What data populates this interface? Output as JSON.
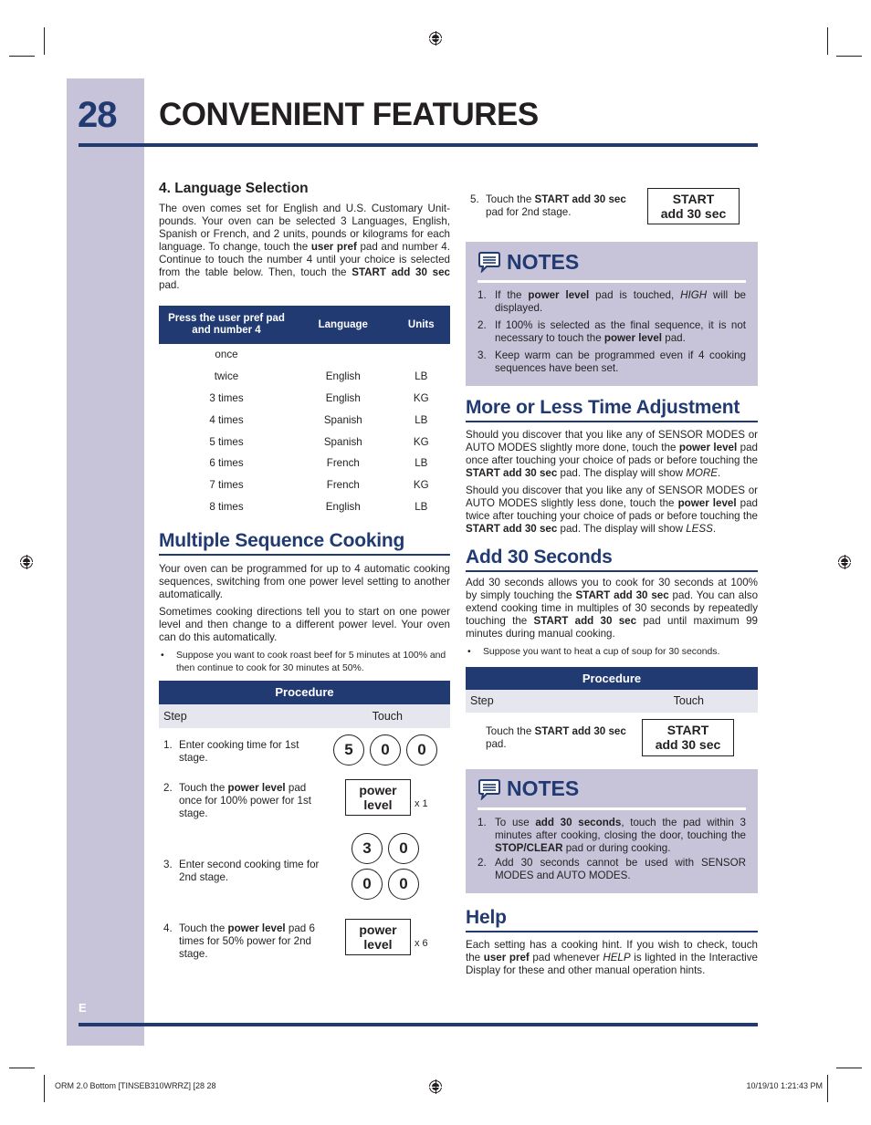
{
  "page": {
    "number": "28",
    "title": "CONVENIENT FEATURES",
    "language_tab": "E",
    "colors": {
      "accent": "#213a72",
      "sidebar": "#c7c4da",
      "notes_bg": "#c7c4da",
      "table_subheader": "#e6e6ee"
    }
  },
  "language_selection": {
    "heading": "4. Language Selection",
    "body_1": "The oven comes set for English and U.S. Customary Unit-pounds. Your oven can be selected 3 Languages, English, Spanish or French, and 2 units, pounds or kilograms for each language. To change, touch the ",
    "body_bold_1": "user pref",
    "body_2": " pad and number 4. Continue to touch the number 4 until your choice is selected from the table below. Then, touch the ",
    "body_bold_2": "START add 30 sec",
    "body_3": " pad.",
    "table": {
      "headers": [
        "Press the user pref pad and number 4",
        "Language",
        "Units"
      ],
      "rows": [
        [
          "once",
          "",
          ""
        ],
        [
          "twice",
          "English",
          "LB"
        ],
        [
          "3 times",
          "English",
          "KG"
        ],
        [
          "4 times",
          "Spanish",
          "LB"
        ],
        [
          "5 times",
          "Spanish",
          "KG"
        ],
        [
          "6 times",
          "French",
          "LB"
        ],
        [
          "7 times",
          "French",
          "KG"
        ],
        [
          "8 times",
          "English",
          "LB"
        ]
      ]
    }
  },
  "multiple_sequence": {
    "heading": "Multiple Sequence Cooking",
    "para_1": "Your oven can be programmed for up to 4 automatic cooking sequences, switching from one power level setting to another automatically.",
    "para_2": "Sometimes cooking directions tell you to start on one power level and then change to a different power level. Your oven can do this automatically.",
    "bullet": "Suppose you want to cook roast beef for 5 minutes at 100% and then continue to cook for 30 minutes at 50%.",
    "procedure": {
      "title": "Procedure",
      "col_step": "Step",
      "col_touch": "Touch",
      "steps": [
        {
          "num": "1.",
          "text": "Enter cooking time for 1st stage.",
          "pads": [
            "5",
            "0",
            "0"
          ]
        },
        {
          "num": "2.",
          "pre": "Touch the ",
          "bold": "power level",
          "post": " pad once for 100% power for 1st stage.",
          "pad_line1": "power",
          "pad_line2": "level",
          "times": "x 1"
        },
        {
          "num": "3.",
          "text": "Enter second cooking time for 2nd stage.",
          "pads": [
            "3",
            "0",
            "0",
            "0"
          ]
        },
        {
          "num": "4.",
          "pre": "Touch the ",
          "bold": "power level",
          "post": " pad 6 times for 50% power for 2nd stage.",
          "pad_line1": "power",
          "pad_line2": "level",
          "times": "x 6"
        },
        {
          "num": "5.",
          "pre": "Touch the ",
          "bold": "START add 30 sec",
          "post": " pad for 2nd stage.",
          "pad_line1": "START",
          "pad_line2": "add 30 sec"
        }
      ]
    }
  },
  "notes_1": {
    "title": "NOTES",
    "items": [
      {
        "num": "1.",
        "a": "If the ",
        "b": "power level",
        "c": " pad is touched, ",
        "i": "HIGH",
        "d": " will be displayed."
      },
      {
        "num": "2.",
        "a": "If 100% is selected as the final sequence, it is not necessary to touch the ",
        "b": "power level",
        "c": " pad."
      },
      {
        "num": "3.",
        "a": "Keep warm can be programmed even if 4 cooking sequences have been set."
      }
    ]
  },
  "more_less": {
    "heading": "More or Less Time Adjustment",
    "p1_a": "Should you discover that you like any of SENSOR MODES or AUTO MODES slightly more done, touch the ",
    "p1_b": "power level",
    "p1_c": " pad once after touching your choice of pads or before touching the ",
    "p1_d": "START add 30 sec",
    "p1_e": " pad. The display will show ",
    "p1_i": "MORE",
    "p1_f": ".",
    "p2_a": "Should you discover that you like any of SENSOR MODES or AUTO MODES slightly less done, touch the ",
    "p2_b": "power level",
    "p2_c": " pad twice after touching your choice of pads or before touching the ",
    "p2_d": "START add 30 sec",
    "p2_e": " pad. The display will show ",
    "p2_i": "LESS",
    "p2_f": "."
  },
  "add30": {
    "heading": "Add 30 Seconds",
    "p_a": "Add 30 seconds allows you to cook for 30 seconds at 100% by simply touching the ",
    "p_b": "START add 30 sec",
    "p_c": " pad. You can also extend cooking time in multiples of 30 seconds by repeatedly touching the ",
    "p_d": "START add 30 sec",
    "p_e": " pad until maximum 99 minutes during manual cooking.",
    "bullet": "Suppose you want to heat a cup of soup for 30 seconds.",
    "procedure": {
      "title": "Procedure",
      "col_step": "Step",
      "col_touch": "Touch",
      "step_pre": "Touch the ",
      "step_bold": "START add 30 sec",
      "step_post": " pad.",
      "pad_line1": "START",
      "pad_line2": "add 30 sec"
    }
  },
  "notes_2": {
    "title": "NOTES",
    "items": [
      {
        "num": "1.",
        "a": "To use ",
        "b": "add 30 seconds",
        "c": ", touch the pad within 3 minutes after cooking, closing the door, touching the ",
        "d": "STOP/CLEAR",
        "e": " pad or during cooking."
      },
      {
        "num": "2.",
        "a": "Add 30 seconds cannot be used with SENSOR MODES and AUTO MODES."
      }
    ]
  },
  "help": {
    "heading": "Help",
    "a": "Each setting has a cooking hint. If you wish to check, touch the ",
    "b": "user pref",
    "c": " pad whenever ",
    "i": "HELP",
    "d": " is lighted in the Interactive Display for these and other manual operation hints."
  },
  "slug": {
    "left": "ORM 2.0 Bottom [TINSEB310WRRZ] [28   28",
    "right": "10/19/10   1:21:43 PM"
  }
}
